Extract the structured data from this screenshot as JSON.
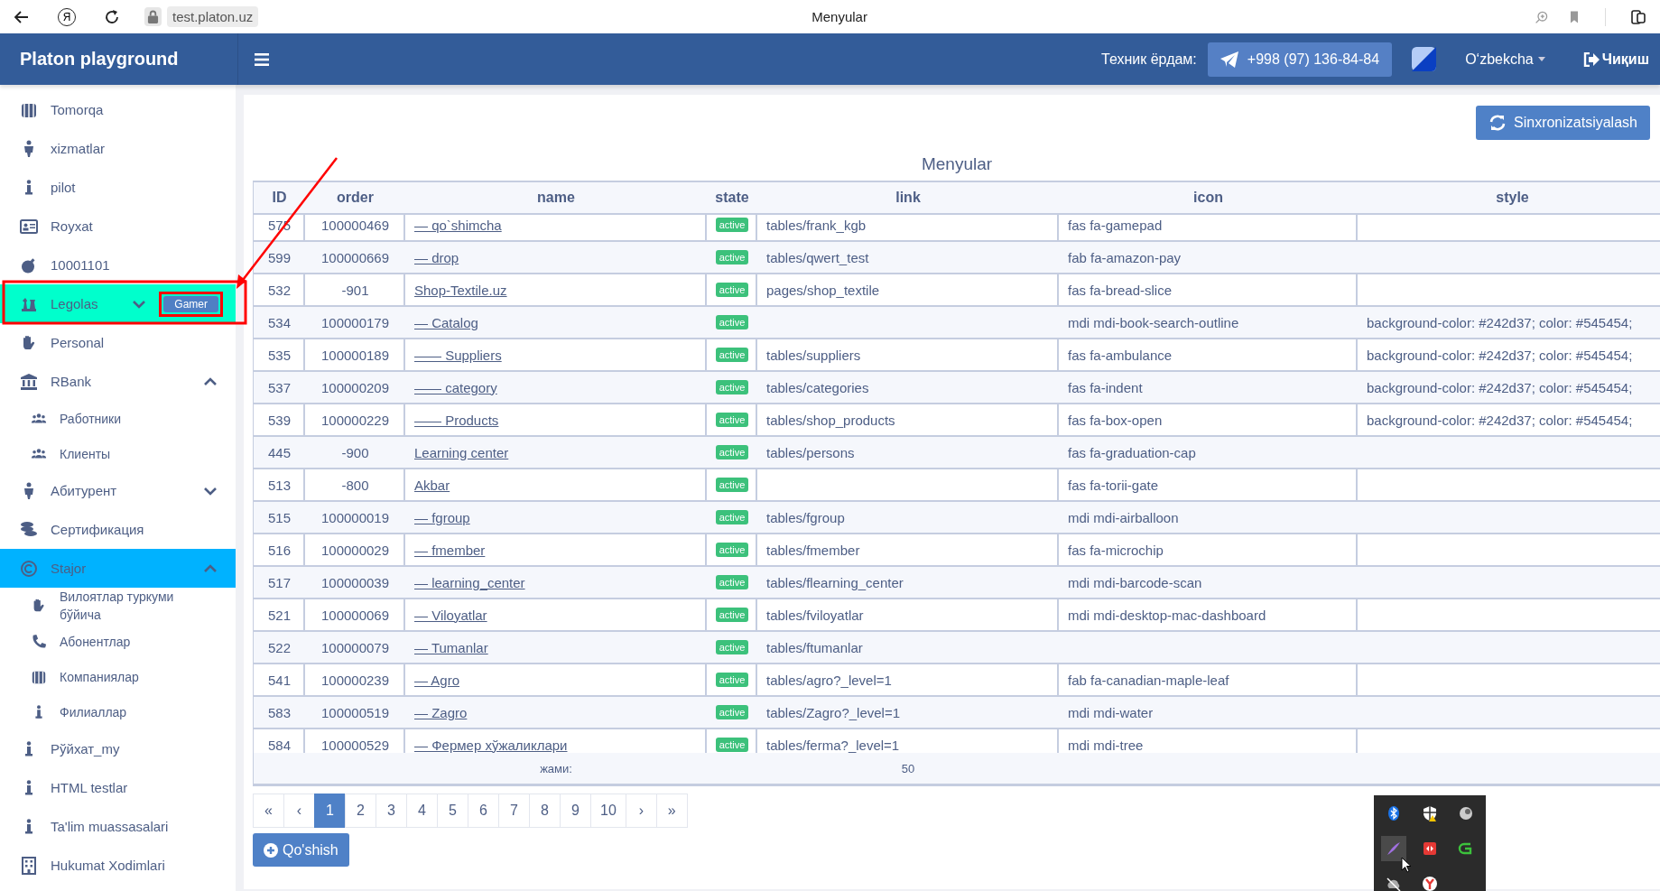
{
  "browser": {
    "logo": "Я",
    "url": "test.platon.uz",
    "title": "Menyular"
  },
  "header": {
    "brand": "Platon playground",
    "support_label": "Техник ёрдам:",
    "phone": "+998 (97) 136-84-84",
    "language": "O‘zbekcha",
    "logout": "Чиқиш"
  },
  "sidebar": {
    "items": [
      {
        "label": "Tomorqa",
        "selected": false,
        "highlighted": false
      },
      {
        "label": "xizmatlar",
        "selected": false,
        "highlighted": false
      },
      {
        "label": "pilot",
        "selected": false,
        "highlighted": false
      },
      {
        "label": "Royxat",
        "selected": false,
        "highlighted": false
      },
      {
        "label": "10001101",
        "selected": false,
        "highlighted": false
      },
      {
        "label": "Legolas",
        "selected": false,
        "highlighted": true,
        "expanded": false,
        "badge": "Gamer"
      },
      {
        "label": "Personal",
        "selected": false,
        "highlighted": false
      },
      {
        "label": "RBank",
        "selected": false,
        "highlighted": false,
        "expanded": true,
        "children": [
          {
            "label": "Работники",
            "selected": false
          },
          {
            "label": "Клиенты",
            "selected": false
          }
        ]
      },
      {
        "label": "Абитурент",
        "selected": false,
        "highlighted": false,
        "expanded": false
      },
      {
        "label": "Сертификация",
        "selected": false,
        "highlighted": false
      },
      {
        "label": "Stajor",
        "selected": true,
        "highlighted": false,
        "expanded": true,
        "children": [
          {
            "label": "Вилоятлар туркуми бўйича",
            "selected": false
          },
          {
            "label": "Абонентлар",
            "selected": false
          },
          {
            "label": "Компаниялар",
            "selected": false
          },
          {
            "label": "Филиаллар",
            "selected": false
          }
        ]
      },
      {
        "label": "Рўйхат_my",
        "selected": false,
        "highlighted": false
      },
      {
        "label": "HTML testlar",
        "selected": false,
        "highlighted": false
      },
      {
        "label": "Ta'lim muassasalari",
        "selected": false,
        "highlighted": false
      },
      {
        "label": "Hukumat Xodimlari",
        "selected": false,
        "highlighted": false
      }
    ]
  },
  "content": {
    "sync_button": "Sinxronizatsiyalash",
    "title": "Menyular",
    "table": {
      "columns": [
        "ID",
        "order",
        "name",
        "state",
        "link",
        "icon",
        "style"
      ],
      "rows": [
        {
          "id": "575",
          "order": "100000469",
          "name": "— qo`shimcha",
          "state": "active",
          "link": "tables/frank_kgb",
          "icon": "fas fa-gamepad",
          "style": ""
        },
        {
          "id": "599",
          "order": "100000669",
          "name": "— drop",
          "state": "active",
          "link": "tables/qwert_test",
          "icon": "fab fa-amazon-pay",
          "style": ""
        },
        {
          "id": "532",
          "order": "-901",
          "name": "Shop-Textile.uz",
          "state": "active",
          "link": "pages/shop_textile",
          "icon": "fas fa-bread-slice",
          "style": ""
        },
        {
          "id": "534",
          "order": "100000179",
          "name": "— Catalog",
          "state": "active",
          "link": "",
          "icon": "mdi mdi-book-search-outline",
          "style": "background-color: #242d37; color: #545454;"
        },
        {
          "id": "535",
          "order": "100000189",
          "name": "—— Suppliers",
          "state": "active",
          "link": "tables/suppliers",
          "icon": "fas fa-ambulance",
          "style": "background-color: #242d37; color: #545454;"
        },
        {
          "id": "537",
          "order": "100000209",
          "name": "—— category",
          "state": "active",
          "link": "tables/categories",
          "icon": "fas fa-indent",
          "style": "background-color: #242d37; color: #545454;"
        },
        {
          "id": "539",
          "order": "100000229",
          "name": "—— Products",
          "state": "active",
          "link": "tables/shop_products",
          "icon": "fas fa-box-open",
          "style": "background-color: #242d37; color: #545454;"
        },
        {
          "id": "445",
          "order": "-900",
          "name": "Learning center",
          "state": "active",
          "link": "tables/persons",
          "icon": "fas fa-graduation-cap",
          "style": ""
        },
        {
          "id": "513",
          "order": "-800",
          "name": "Akbar",
          "state": "active",
          "link": "",
          "icon": "fas fa-torii-gate",
          "style": ""
        },
        {
          "id": "515",
          "order": "100000019",
          "name": "— fgroup",
          "state": "active",
          "link": "tables/fgroup",
          "icon": "mdi mdi-airballoon",
          "style": ""
        },
        {
          "id": "516",
          "order": "100000029",
          "name": "— fmember",
          "state": "active",
          "link": "tables/fmember",
          "icon": "fas fa-microchip",
          "style": ""
        },
        {
          "id": "517",
          "order": "100000039",
          "name": "— learning_center",
          "state": "active",
          "link": "tables/flearning_center",
          "icon": "mdi mdi-barcode-scan",
          "style": ""
        },
        {
          "id": "521",
          "order": "100000069",
          "name": "— Viloyatlar",
          "state": "active",
          "link": "tables/fviloyatlar",
          "icon": "mdi mdi-desktop-mac-dashboard",
          "style": ""
        },
        {
          "id": "522",
          "order": "100000079",
          "name": "— Tumanlar",
          "state": "active",
          "link": "tables/ftumanlar",
          "icon": "",
          "style": ""
        },
        {
          "id": "541",
          "order": "100000239",
          "name": "— Agro",
          "state": "active",
          "link": "tables/agro?_level=1",
          "icon": "fab fa-canadian-maple-leaf",
          "style": ""
        },
        {
          "id": "583",
          "order": "100000519",
          "name": "— Zagro",
          "state": "active",
          "link": "tables/Zagro?_level=1",
          "icon": "mdi mdi-water",
          "style": ""
        },
        {
          "id": "584",
          "order": "100000529",
          "name": "— Фермер хўжаликлари",
          "state": "active",
          "link": "tables/ferma?_level=1",
          "icon": "mdi mdi-tree",
          "style": ""
        }
      ],
      "footer": {
        "name": "жами:",
        "link": "50"
      }
    },
    "pagination": [
      {
        "label": "«",
        "selected": false
      },
      {
        "label": "‹",
        "selected": false
      },
      {
        "label": "1",
        "selected": true
      },
      {
        "label": "2",
        "selected": false
      },
      {
        "label": "3",
        "selected": false
      },
      {
        "label": "4",
        "selected": false
      },
      {
        "label": "5",
        "selected": false
      },
      {
        "label": "6",
        "selected": false
      },
      {
        "label": "7",
        "selected": false
      },
      {
        "label": "8",
        "selected": false
      },
      {
        "label": "9",
        "selected": false
      },
      {
        "label": "10",
        "selected": false
      },
      {
        "label": "›",
        "selected": false
      },
      {
        "label": "»",
        "selected": false
      }
    ],
    "add_button": "Qo'shish"
  }
}
